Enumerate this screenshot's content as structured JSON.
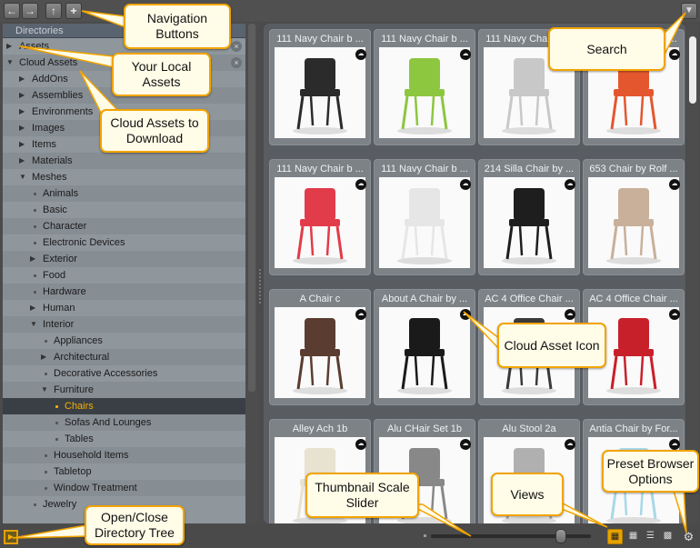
{
  "navigation": {
    "back_icon": "arrow-left-icon",
    "forward_icon": "arrow-right-icon",
    "up_icon": "folder-up-icon",
    "add_icon": "plus-icon",
    "filter_icon": "filter-icon"
  },
  "directories": {
    "header": "Directories",
    "items": [
      {
        "label": "Assets",
        "twisty": "▶"
      },
      {
        "label": "Cloud Assets",
        "twisty": "▼"
      },
      {
        "label": "AddOns",
        "twisty": "▶"
      },
      {
        "label": "Assemblies",
        "twisty": "▶"
      },
      {
        "label": "Environments",
        "twisty": "▶"
      },
      {
        "label": "Images",
        "twisty": "▶"
      },
      {
        "label": "Items",
        "twisty": "▶"
      },
      {
        "label": "Materials",
        "twisty": "▶"
      },
      {
        "label": "Meshes",
        "twisty": "▼"
      },
      {
        "label": "Animals",
        "twisty": ""
      },
      {
        "label": "Basic",
        "twisty": ""
      },
      {
        "label": "Character",
        "twisty": ""
      },
      {
        "label": "Electronic Devices",
        "twisty": ""
      },
      {
        "label": "Exterior",
        "twisty": "▶"
      },
      {
        "label": "Food",
        "twisty": ""
      },
      {
        "label": "Hardware",
        "twisty": ""
      },
      {
        "label": "Human",
        "twisty": "▶"
      },
      {
        "label": "Interior",
        "twisty": "▼"
      },
      {
        "label": "Appliances",
        "twisty": ""
      },
      {
        "label": "Architectural",
        "twisty": "▶"
      },
      {
        "label": "Decorative Accessories",
        "twisty": ""
      },
      {
        "label": "Furniture",
        "twisty": "▼"
      },
      {
        "label": "Chairs",
        "twisty": ""
      },
      {
        "label": "Sofas And Lounges",
        "twisty": ""
      },
      {
        "label": "Tables",
        "twisty": ""
      },
      {
        "label": "Household Items",
        "twisty": ""
      },
      {
        "label": "Tabletop",
        "twisty": ""
      },
      {
        "label": "Window Treatment",
        "twisty": ""
      },
      {
        "label": "Jewelry",
        "twisty": ""
      }
    ]
  },
  "assets": [
    {
      "title": "111 Navy Chair b ...",
      "color": "#2b2b2b",
      "cloud": true
    },
    {
      "title": "111 Navy Chair b ...",
      "color": "#8dc63f",
      "cloud": true
    },
    {
      "title": "111 Navy Chair b ...",
      "color": "#c8c8c8",
      "cloud": true
    },
    {
      "title": "111 Navy Chair b ...",
      "color": "#e4572e",
      "cloud": true
    },
    {
      "title": "111 Navy Chair b ...",
      "color": "#e23b4a",
      "cloud": true
    },
    {
      "title": "111 Navy Chair b ...",
      "color": "#e6e6e6",
      "cloud": true
    },
    {
      "title": "214 Silla Chair by ...",
      "color": "#1e1e1e",
      "cloud": true
    },
    {
      "title": "653 Chair by Rolf ...",
      "color": "#c8b09a",
      "cloud": true
    },
    {
      "title": "A Chair c",
      "color": "#5a3c30",
      "cloud": true
    },
    {
      "title": "About A Chair by ...",
      "color": "#1a1a1a",
      "cloud": true
    },
    {
      "title": "AC 4 Office Chair ...",
      "color": "#3a3a3a",
      "cloud": true
    },
    {
      "title": "AC 4 Office Chair ...",
      "color": "#c8202a",
      "cloud": true
    },
    {
      "title": "Alley Ach 1b",
      "color": "#e8e2d0",
      "cloud": true
    },
    {
      "title": "Alu CHair Set 1b",
      "color": "#888888",
      "cloud": true
    },
    {
      "title": "Alu Stool 2a",
      "color": "#b0b0b0",
      "cloud": true
    },
    {
      "title": "Antia Chair by For...",
      "color": "#a8d8e8",
      "cloud": true
    }
  ],
  "bottom": {
    "toggle_icon": "directory-tree-toggle-icon",
    "views": [
      "large-grid-view-icon",
      "medium-grid-view-icon",
      "list-view-icon",
      "small-grid-view-icon"
    ],
    "options_icon": "gear-icon"
  },
  "callouts": {
    "navigation": "Navigation Buttons",
    "local_assets": "Your Local Assets",
    "cloud_assets": "Cloud Assets to Download",
    "search": "Search",
    "cloud_icon": "Cloud Asset Icon",
    "scale_slider": "Thumbnail Scale Slider",
    "views": "Views",
    "options": "Preset Browser Options",
    "dir_tree": "Open/Close Directory Tree"
  },
  "colors": {
    "accent": "#f2a400",
    "selected": "#f5b000"
  }
}
